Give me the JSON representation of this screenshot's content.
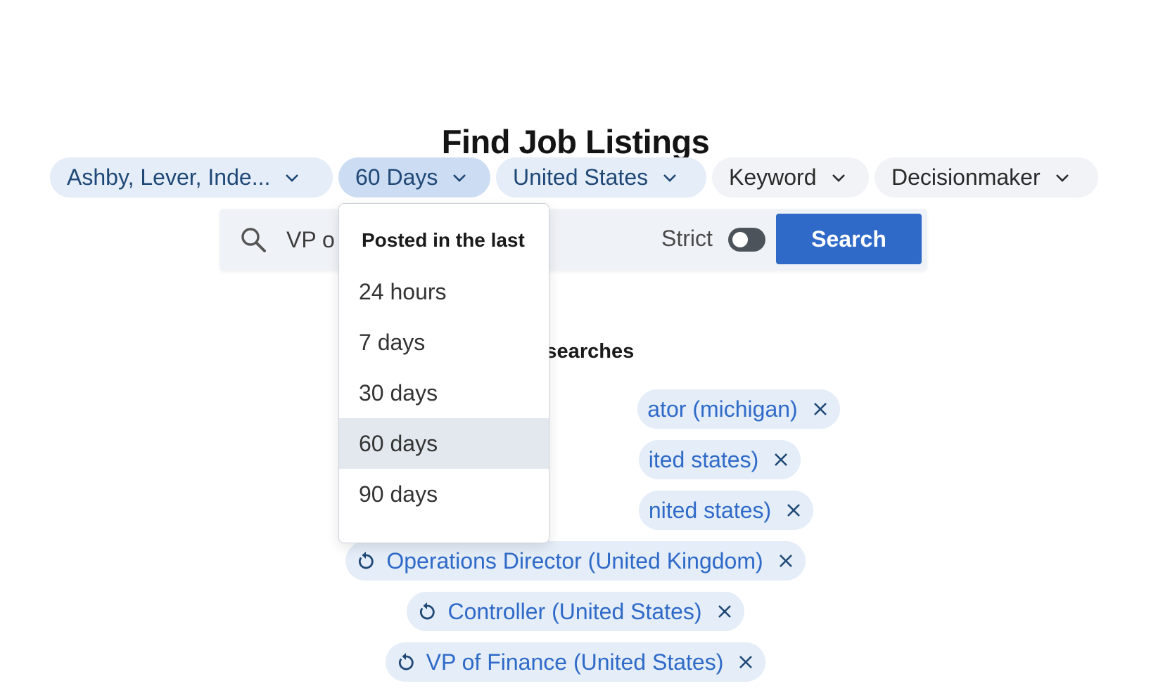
{
  "page": {
    "title": "Find Job Listings"
  },
  "filters": {
    "sources": "Ashby, Lever, Inde...",
    "posted": "60 Days",
    "location": "United States",
    "keyword": "Keyword",
    "decisionmaker": "Decisionmaker"
  },
  "search": {
    "query_visible": "VP o",
    "strict_label": "Strict",
    "strict_enabled": false,
    "button_label": "Search"
  },
  "dropdown": {
    "header": "Posted in the last",
    "options": [
      "24 hours",
      "7 days",
      "30 days",
      "60 days",
      "90 days"
    ],
    "selected": "60 days"
  },
  "recent": {
    "heading_visible": "nt searches",
    "items": [
      "ator (michigan)",
      "ited states)",
      "nited states)",
      "Operations Director (United Kingdom)",
      "Controller (United States)",
      "VP of Finance (United States)"
    ]
  },
  "colors": {
    "accent": "#2f6ac8",
    "chip_blue": "#e4edf8",
    "chip_active": "#ccddf3",
    "chip_gray": "#f1f3f6",
    "chip_text": "#1f4876",
    "selected_option": "#e2e8ee"
  },
  "icons": {
    "chevron": "chevron-down-icon",
    "search": "search-icon",
    "redo": "redo-icon",
    "remove": "close-icon"
  }
}
